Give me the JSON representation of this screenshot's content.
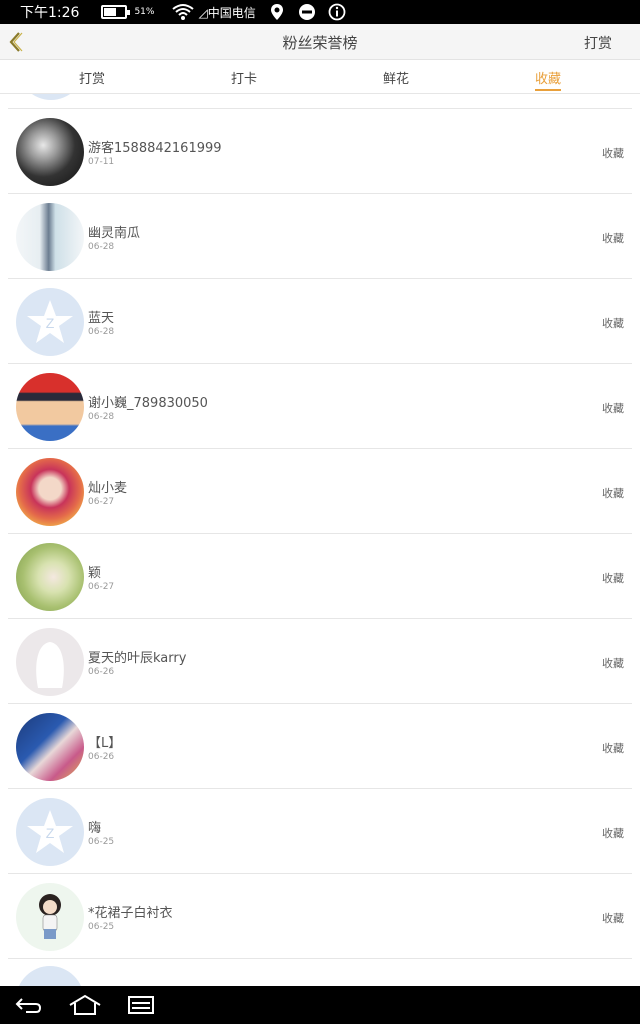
{
  "status_bar": {
    "time": "下午1:26",
    "battery_pct": "51%",
    "battery_level": 0.51,
    "carrier": "◿中国电信"
  },
  "header": {
    "back_icon": "chevron-left-icon",
    "title": "粉丝荣誉榜",
    "action_label": "打赏"
  },
  "tabs": [
    {
      "label": "打赏",
      "active": false
    },
    {
      "label": "打卡",
      "active": false
    },
    {
      "label": "鲜花",
      "active": false
    },
    {
      "label": "收藏",
      "active": true
    }
  ],
  "list": [
    {
      "name": "游客1588842161999",
      "date": "07-11",
      "action": "收藏",
      "avatar": "dark-photo"
    },
    {
      "name": "幽灵南瓜",
      "date": "06-28",
      "action": "收藏",
      "avatar": "anime-girl-light"
    },
    {
      "name": "蓝天",
      "date": "06-28",
      "action": "收藏",
      "avatar": "default-star"
    },
    {
      "name": "谢小巍_789830050",
      "date": "06-28",
      "action": "收藏",
      "avatar": "cartoon-boy"
    },
    {
      "name": "灿小麦",
      "date": "06-27",
      "action": "收藏",
      "avatar": "anime-red"
    },
    {
      "name": "颖",
      "date": "06-27",
      "action": "收藏",
      "avatar": "flower-green"
    },
    {
      "name": "夏天的叶辰karry",
      "date": "06-26",
      "action": "收藏",
      "avatar": "default-silhouette"
    },
    {
      "name": "【L】",
      "date": "06-26",
      "action": "收藏",
      "avatar": "anime-blue"
    },
    {
      "name": "嗨",
      "date": "06-25",
      "action": "收藏",
      "avatar": "default-star"
    },
    {
      "name": "*花裙子白衬衣",
      "date": "06-25",
      "action": "收藏",
      "avatar": "chibi-girl"
    }
  ],
  "colors": {
    "accent": "#e9a03b",
    "divider": "#e6e6e6",
    "default_avatar": "#dbe6f4"
  },
  "nav_bar": {
    "icons": [
      "back-icon",
      "home-icon",
      "recent-apps-icon"
    ]
  }
}
